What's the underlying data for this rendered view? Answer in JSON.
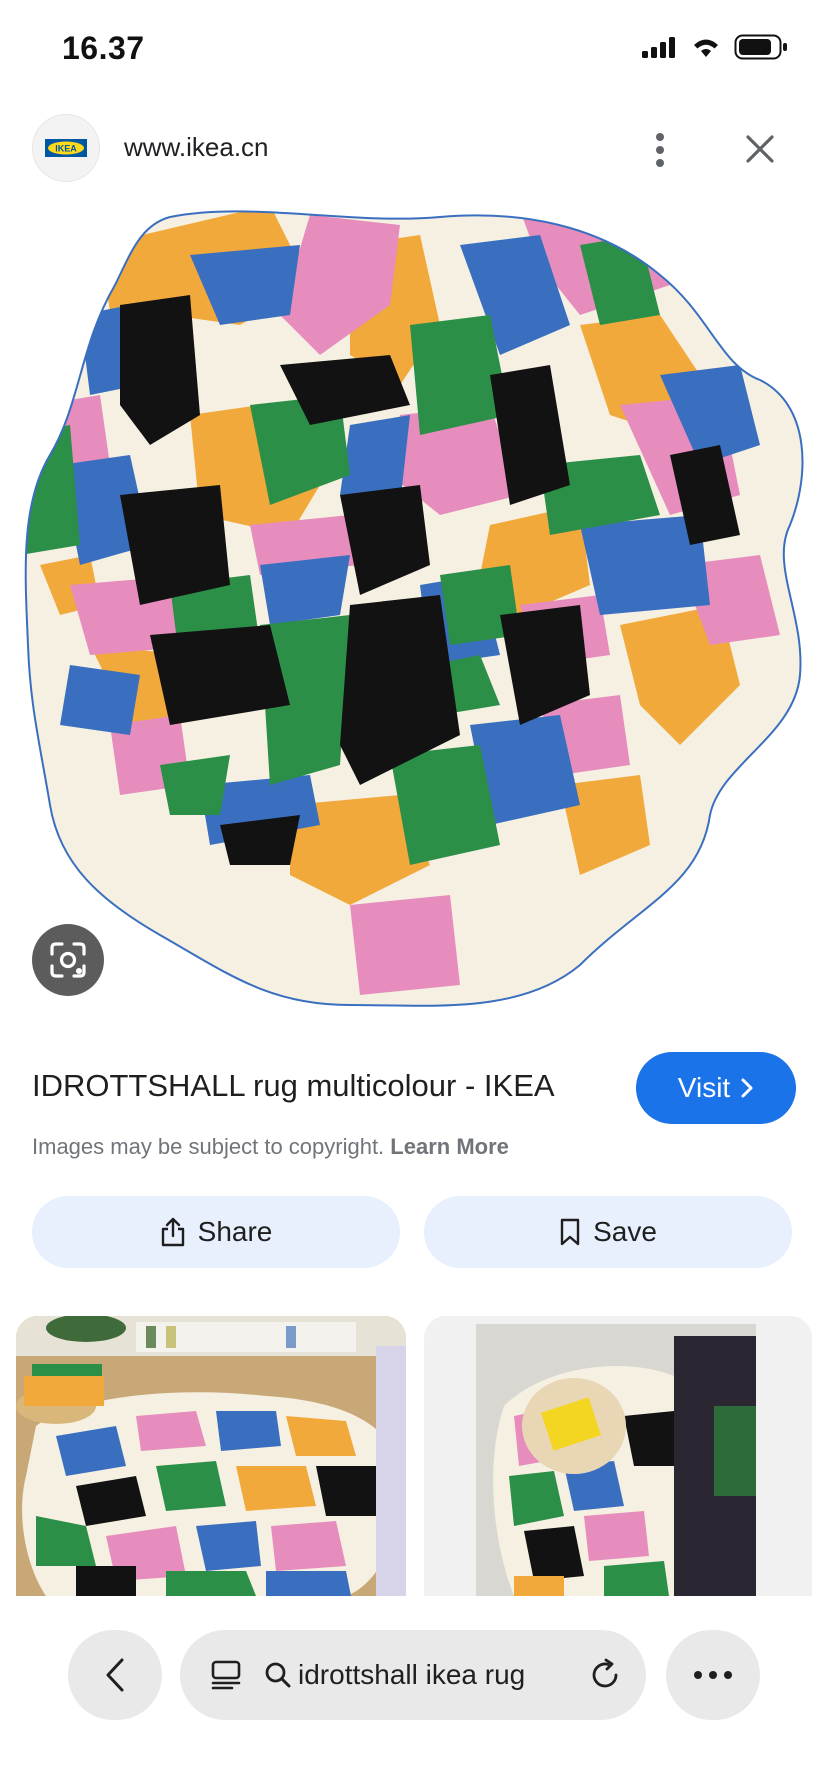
{
  "status_bar": {
    "time": "16.37"
  },
  "site": {
    "logo_text": "IKEA",
    "url": "www.ikea.cn"
  },
  "result": {
    "title": "IDROTTSHALL rug multicolour - IKEA",
    "visit_label": "Visit",
    "copyright_text": "Images may be subject to copyright.",
    "learn_more": "Learn More"
  },
  "actions": {
    "share_label": "Share",
    "save_label": "Save"
  },
  "bottom_bar": {
    "search_query": "idrottshall ikea rug"
  },
  "colors": {
    "accent": "#1a73e8",
    "action_bg": "#e8f0fe",
    "rug_orange": "#f2a93b",
    "rug_pink": "#e68dbd",
    "rug_blue": "#3a6fc0",
    "rug_green": "#2b8f47",
    "rug_black": "#121212",
    "rug_cream": "#f5f0e1"
  },
  "icons": [
    "signal-icon",
    "wifi-icon",
    "battery-icon",
    "kebab-menu-icon",
    "close-icon",
    "lens-icon",
    "chevron-right-icon",
    "share-icon",
    "bookmark-icon",
    "back-icon",
    "tabs-icon",
    "search-icon",
    "reload-icon",
    "more-icon"
  ]
}
